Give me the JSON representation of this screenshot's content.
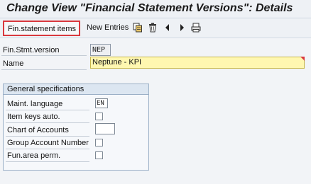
{
  "window": {
    "title": "Change View \"Financial Statement Versions\": Details"
  },
  "toolbar": {
    "fin_stmt_items_label": "Fin.statement items",
    "new_entries_label": "New Entries",
    "icons": [
      "copy-icon",
      "delete-icon",
      "previous-entry-icon",
      "next-entry-icon",
      "print-icon"
    ]
  },
  "header_fields": {
    "fin_stmt_version_label": "Fin.Stmt.version",
    "fin_stmt_version_value": "NEP",
    "name_label": "Name",
    "name_value": "Neptune - KPI"
  },
  "general_specifications": {
    "title": "General specifications",
    "maint_language_label": "Maint. language",
    "maint_language_value": "EN",
    "item_keys_auto_label": "Item keys auto.",
    "item_keys_auto_checked": false,
    "chart_of_accounts_label": "Chart of Accounts",
    "chart_of_accounts_value": "",
    "group_account_number_label": "Group Account Number",
    "group_account_number_checked": false,
    "fun_area_perm_label": "Fun.area perm.",
    "fun_area_perm_checked": false
  },
  "colors": {
    "required_field_bg": "#fff7b0",
    "highlight_border": "#d9383e",
    "group_header_bg": "#dce6f1"
  }
}
